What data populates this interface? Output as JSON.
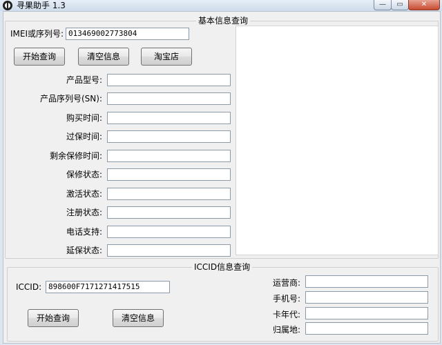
{
  "window": {
    "title": "寻果助手 1.3",
    "minimize_glyph": "—",
    "maximize_glyph": "▭",
    "close_glyph": "✕"
  },
  "basic": {
    "group_title": "基本信息查询",
    "imei_label": "IMEI或序列号:",
    "imei_value": "013469002773804",
    "buttons": {
      "start": "开始查询",
      "clear": "清空信息",
      "taobao": "淘宝店"
    },
    "fields": [
      {
        "label": "产品型号:",
        "value": ""
      },
      {
        "label": "产品序列号(SN):",
        "value": ""
      },
      {
        "label": "购买时间:",
        "value": ""
      },
      {
        "label": "过保时间:",
        "value": ""
      },
      {
        "label": "剩余保修时间:",
        "value": ""
      },
      {
        "label": "保修状态:",
        "value": ""
      },
      {
        "label": "激活状态:",
        "value": ""
      },
      {
        "label": "注册状态:",
        "value": ""
      },
      {
        "label": "电话支持:",
        "value": ""
      },
      {
        "label": "延保状态:",
        "value": ""
      }
    ],
    "result_text": ""
  },
  "iccid": {
    "group_title": "ICCID信息查询",
    "iccid_label": "ICCID:",
    "iccid_value": "898600F7171271417515",
    "buttons": {
      "start": "开始查询",
      "clear": "清空信息"
    },
    "fields": [
      {
        "label": "运营商:",
        "value": ""
      },
      {
        "label": "手机号:",
        "value": ""
      },
      {
        "label": "卡年代:",
        "value": ""
      },
      {
        "label": "归属地:",
        "value": ""
      }
    ]
  }
}
